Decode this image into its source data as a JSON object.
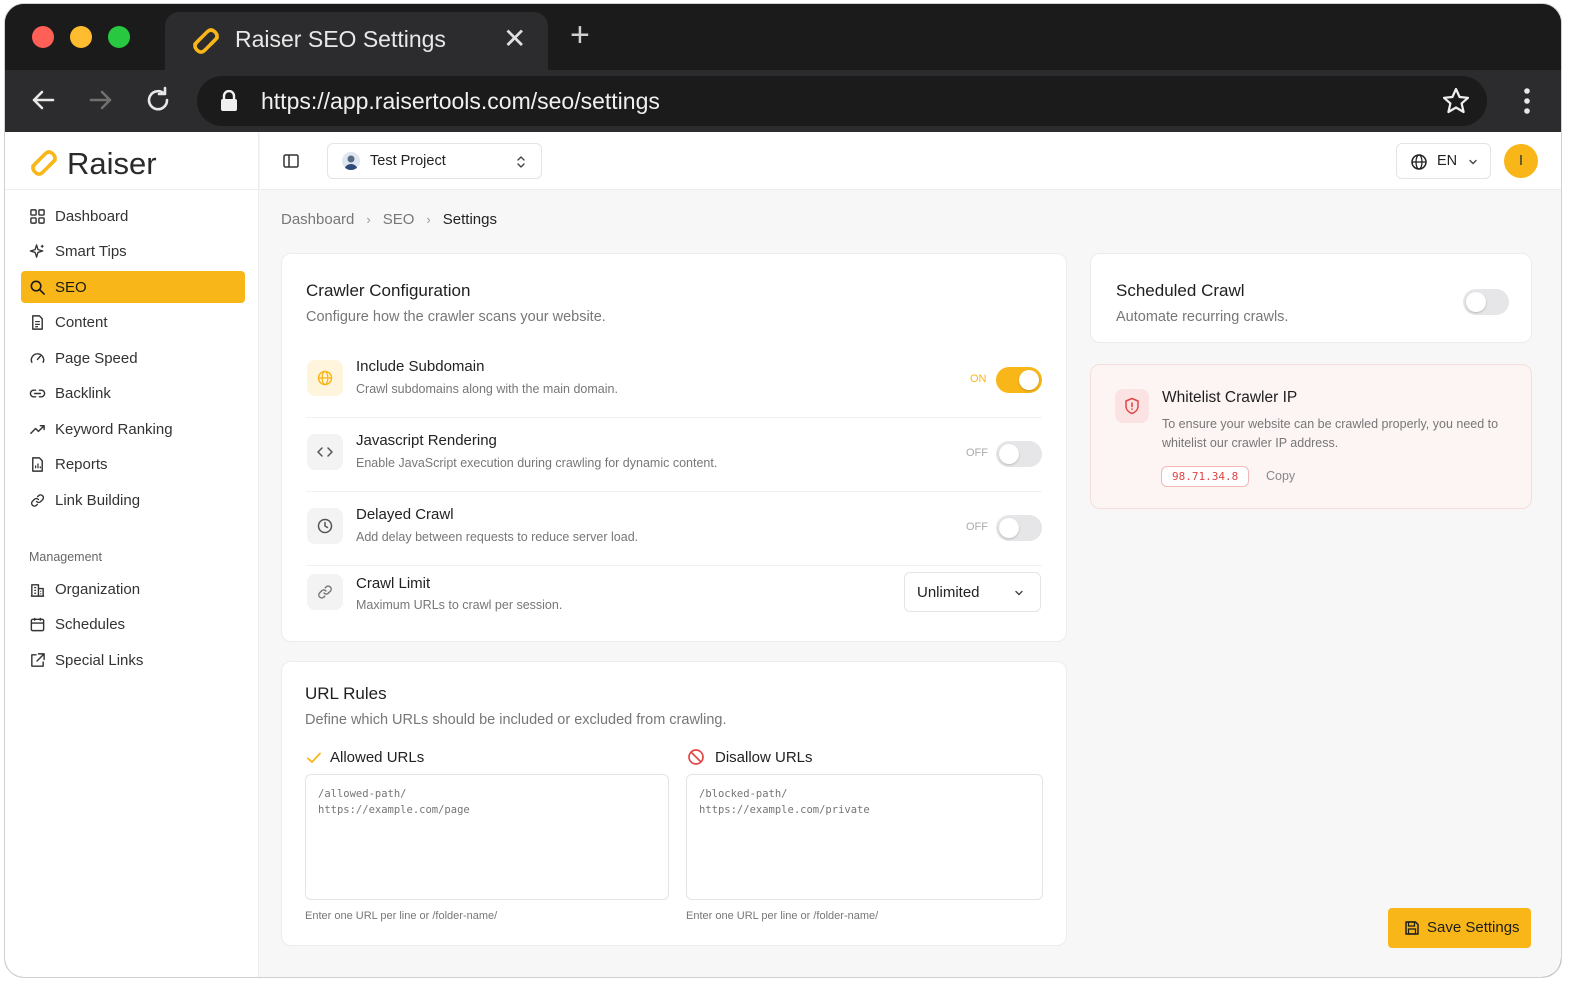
{
  "browser": {
    "tab_title": "Raiser SEO Settings",
    "tab_close": "✕",
    "new_tab": "+",
    "url": "https://app.raisertools.com/seo/settings",
    "traffic_colors": [
      "#fe5f57",
      "#febc2e",
      "#28c840"
    ]
  },
  "brand": {
    "name": "Raiser",
    "accent": "#f8b618"
  },
  "sidebar": {
    "items": [
      {
        "label": "Dashboard",
        "icon": "dashboard-icon"
      },
      {
        "label": "Smart Tips",
        "icon": "sparkle-icon"
      },
      {
        "label": "SEO",
        "icon": "search-icon",
        "active": true
      },
      {
        "label": "Content",
        "icon": "document-icon"
      },
      {
        "label": "Page Speed",
        "icon": "gauge-icon"
      },
      {
        "label": "Backlink",
        "icon": "link-icon"
      },
      {
        "label": "Keyword Ranking",
        "icon": "trend-icon"
      },
      {
        "label": "Reports",
        "icon": "report-icon"
      },
      {
        "label": "Link Building",
        "icon": "chain-icon"
      }
    ],
    "section_label": "Management",
    "management_items": [
      {
        "label": "Organization",
        "icon": "building-icon"
      },
      {
        "label": "Schedules",
        "icon": "calendar-icon"
      },
      {
        "label": "Special Links",
        "icon": "external-link-icon"
      }
    ]
  },
  "topbar": {
    "project": "Test Project",
    "language": "EN",
    "user_initial": "I"
  },
  "breadcrumb": {
    "items": [
      "Dashboard",
      "SEO",
      "Settings"
    ],
    "separator": "›"
  },
  "crawler": {
    "title": "Crawler Configuration",
    "subtitle": "Configure how the crawler scans your website.",
    "settings": [
      {
        "title": "Include Subdomain",
        "desc": "Crawl subdomains along with the main domain.",
        "state": "ON",
        "on": true
      },
      {
        "title": "Javascript Rendering",
        "desc": "Enable JavaScript execution during crawling for dynamic content.",
        "state": "OFF",
        "on": false
      },
      {
        "title": "Delayed Crawl",
        "desc": "Add delay between requests to reduce server load.",
        "state": "OFF",
        "on": false
      },
      {
        "title": "Crawl Limit",
        "desc": "Maximum URLs to crawl per session.",
        "value": "Unlimited"
      }
    ]
  },
  "url_rules": {
    "title": "URL Rules",
    "subtitle": "Define which URLs should be included or excluded from crawling.",
    "allowed": {
      "label": "Allowed URLs",
      "placeholder": "/allowed-path/\nhttps://example.com/page",
      "hint": "Enter one URL per line or /folder-name/"
    },
    "disallowed": {
      "label": "Disallow URLs",
      "placeholder": "/blocked-path/\nhttps://example.com/private",
      "hint": "Enter one URL per line or /folder-name/"
    }
  },
  "scheduled": {
    "title": "Scheduled Crawl",
    "subtitle": "Automate recurring crawls.",
    "on": false
  },
  "whitelist": {
    "title": "Whitelist Crawler IP",
    "desc_line1": "To ensure your website can be crawled properly, you need to",
    "desc_line2": "whitelist our crawler IP address.",
    "ip": "98.71.34.8",
    "copy_label": "Copy"
  },
  "save_label": "Save Settings"
}
